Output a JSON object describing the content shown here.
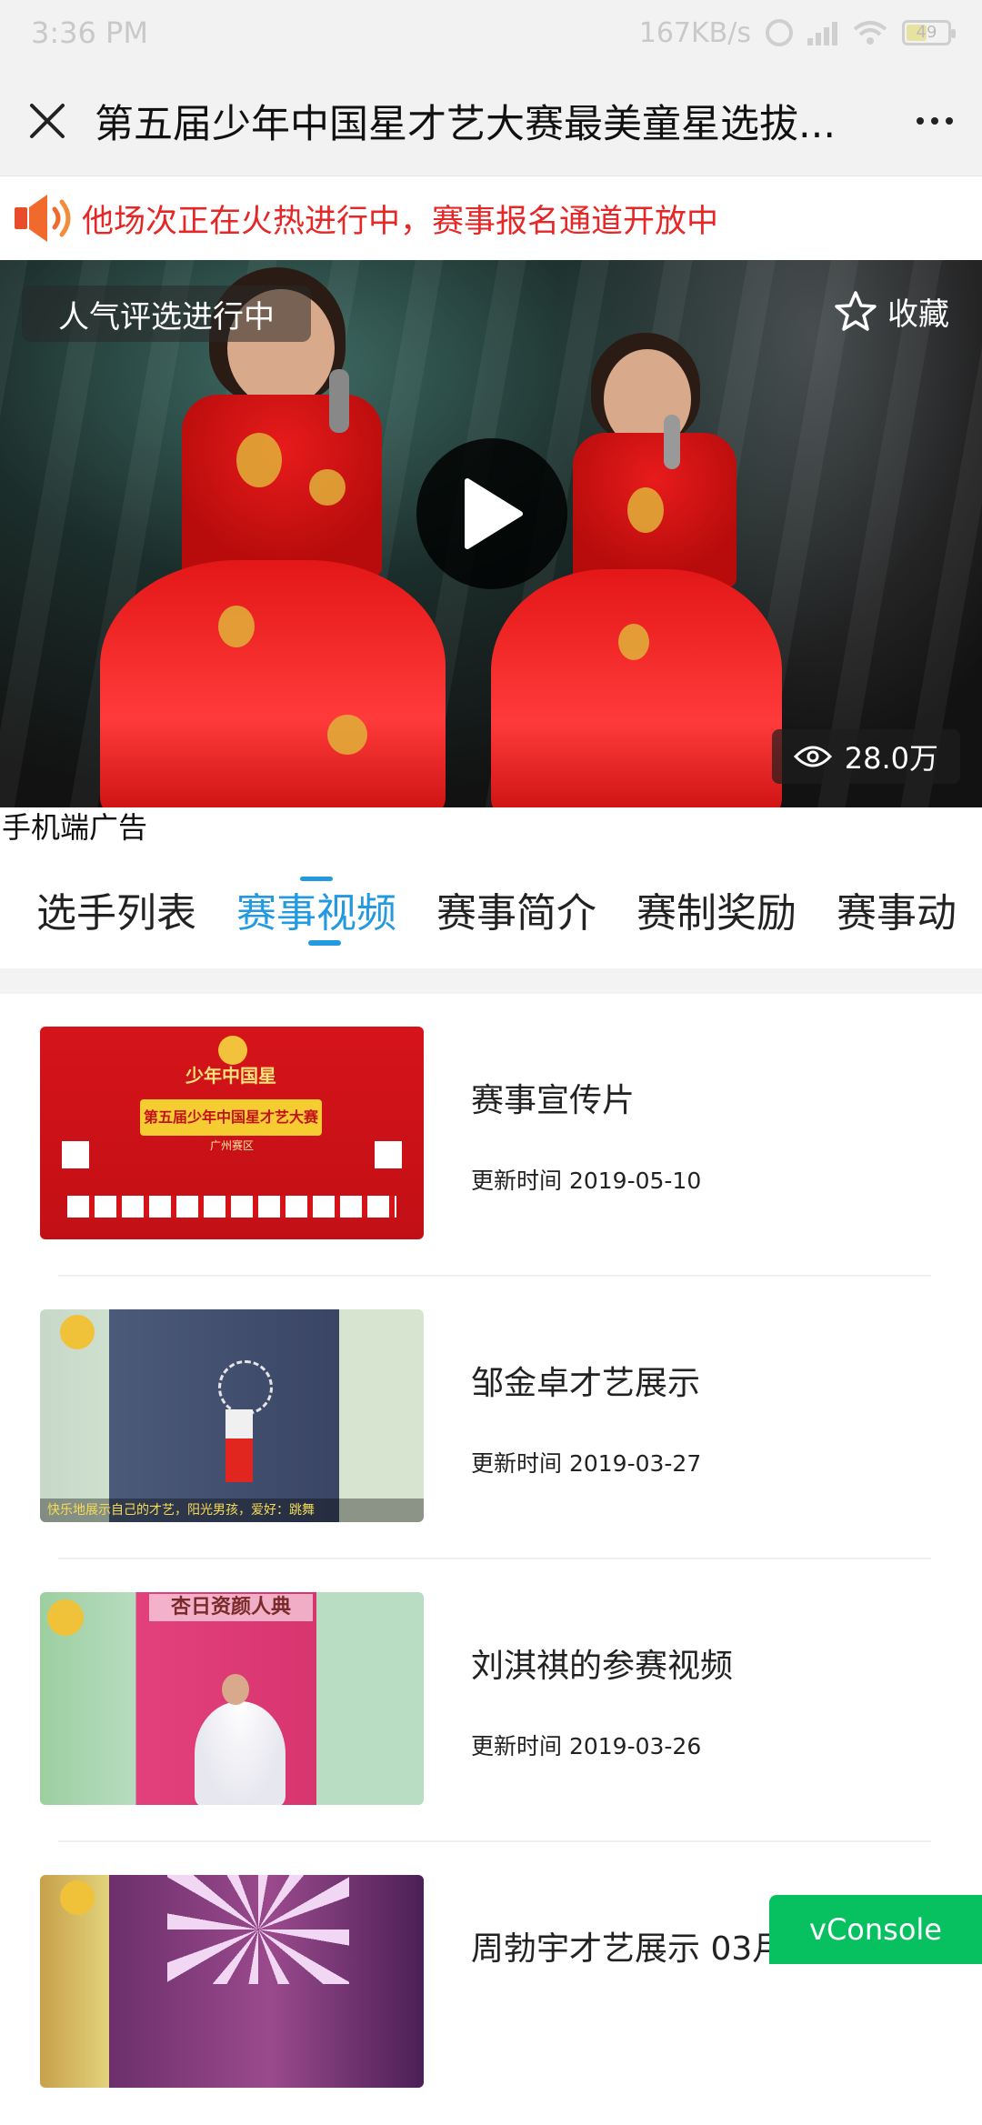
{
  "status_bar": {
    "time": "3:36 PM",
    "net_speed": "167KB/s",
    "battery": "49"
  },
  "header": {
    "title": "第五届少年中国星才艺大赛最美童星选拔...",
    "close_icon": "close-icon",
    "more_icon": "more-dots-icon"
  },
  "notice": {
    "icon": "speaker-icon",
    "text": "他场次正在火热进行中，赛事报名通道开放中",
    "color": "#e52727"
  },
  "hero": {
    "badge": "人气评选进行中",
    "collect_label": "收藏",
    "views": "28.0万"
  },
  "ad_label": "手机端广告",
  "tabs": [
    {
      "label": "选手列表",
      "active": false
    },
    {
      "label": "赛事视频",
      "active": true
    },
    {
      "label": "赛事简介",
      "active": false
    },
    {
      "label": "赛制奖励",
      "active": false
    },
    {
      "label": "赛事动",
      "active": false
    }
  ],
  "accent_color": "#2399e0",
  "videos": [
    {
      "title": "赛事宣传片",
      "date": "更新时间 2019-05-10",
      "thumb_title": "第五届少年中国星才艺大赛",
      "thumb_sub": "广州赛区",
      "thumb_logo": "少年中国星"
    },
    {
      "title": "邹金卓才艺展示",
      "date": "更新时间 2019-03-27",
      "thumb_caption": "快乐地展示自己的才艺，阳光男孩，爱好：跳舞"
    },
    {
      "title": "刘淇祺的参赛视频",
      "date": "更新时间 2019-03-26",
      "thumb_banner": "杏日资颜人典"
    },
    {
      "title": "周勃宇才艺展示 03月",
      "date": ""
    }
  ],
  "vconsole": "vConsole"
}
